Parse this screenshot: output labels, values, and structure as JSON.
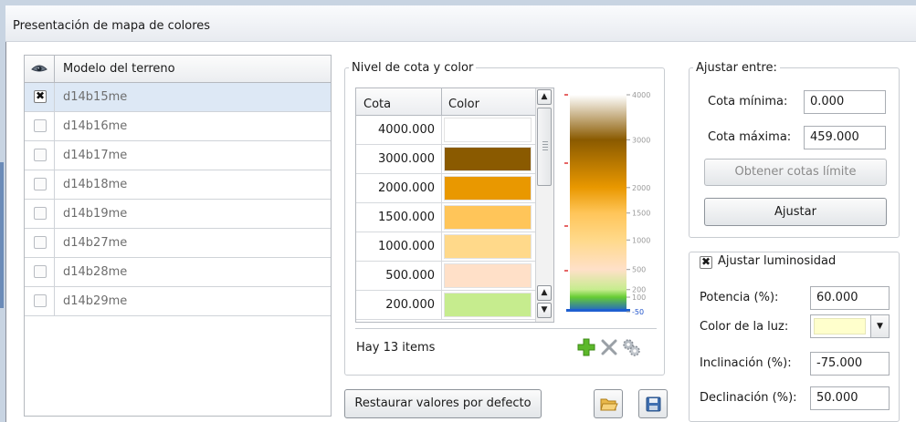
{
  "window": {
    "title": "Presentación de mapa de colores"
  },
  "terrain": {
    "column_header": "Modelo del terreno",
    "visibility_icon": "eye-icon",
    "rows": [
      {
        "name": "d14b15me",
        "checked": true,
        "selected": true
      },
      {
        "name": "d14b16me",
        "checked": false
      },
      {
        "name": "d14b17me",
        "checked": false
      },
      {
        "name": "d14b18me",
        "checked": false
      },
      {
        "name": "d14b19me",
        "checked": false
      },
      {
        "name": "d14b27me",
        "checked": false
      },
      {
        "name": "d14b28me",
        "checked": false
      },
      {
        "name": "d14b29me",
        "checked": false
      }
    ]
  },
  "levels": {
    "group_title": "Nivel de cota y color",
    "col_cota": "Cota",
    "col_color": "Color",
    "rows": [
      {
        "cota": "4000.000",
        "color": "#ffffff"
      },
      {
        "cota": "3000.000",
        "color": "#8a5a00"
      },
      {
        "cota": "2000.000",
        "color": "#e99800"
      },
      {
        "cota": "1500.000",
        "color": "#ffc559"
      },
      {
        "cota": "1000.000",
        "color": "#ffd98a"
      },
      {
        "cota": "500.000",
        "color": "#ffe0c8"
      },
      {
        "cota": "200.000",
        "color": "#c6ec8e"
      }
    ],
    "count_label": "Hay 13 items",
    "ramp_labels": [
      "4000",
      "3000",
      "2000",
      "1500",
      "1000",
      "500",
      "200",
      "100",
      "-50"
    ],
    "ramp_label_colors": {
      "default": "#9a9a9a",
      "negative": "#2255cc"
    },
    "action_icons": [
      "plus-icon",
      "delete-x-icon",
      "gears-icon"
    ]
  },
  "adjust": {
    "group_title": "Ajustar entre:",
    "min_label": "Cota mínima:",
    "min_value": "0.000",
    "max_label": "Cota máxima:",
    "max_value": "459.000",
    "get_limits_button": "Obtener cotas límite",
    "adjust_button": "Ajustar"
  },
  "luminosity": {
    "checkbox_label": "Ajustar luminosidad",
    "checked": true,
    "power_label": "Potencia (%):",
    "power_value": "60.000",
    "light_color_label": "Color de la luz:",
    "light_color": "#ffffcc",
    "inclination_label": "Inclinación (%):",
    "inclination_value": "-75.000",
    "declination_label": "Declinación (%):",
    "declination_value": "50.000"
  },
  "footer": {
    "restore_button": "Restaurar valores por defecto",
    "open_icon": "folder-open-icon",
    "save_icon": "save-disk-icon"
  }
}
